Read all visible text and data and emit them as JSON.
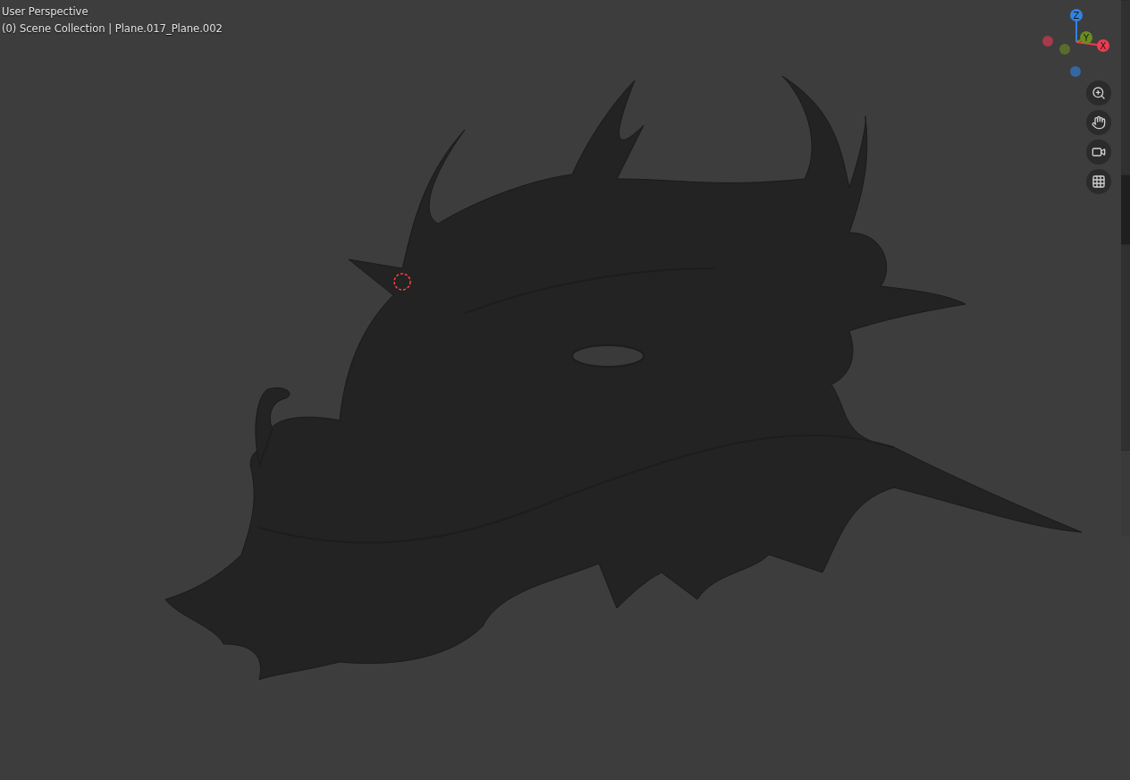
{
  "viewport": {
    "view_name": "User Perspective",
    "object_info": "(0) Scene Collection | Plane.017_Plane.002"
  },
  "gizmo": {
    "axes": [
      {
        "label": "Z",
        "color": "#2f83e6"
      },
      {
        "label": "Y",
        "color": "#6a8d1f"
      },
      {
        "label": "X",
        "color": "#ee3b52"
      }
    ]
  }
}
